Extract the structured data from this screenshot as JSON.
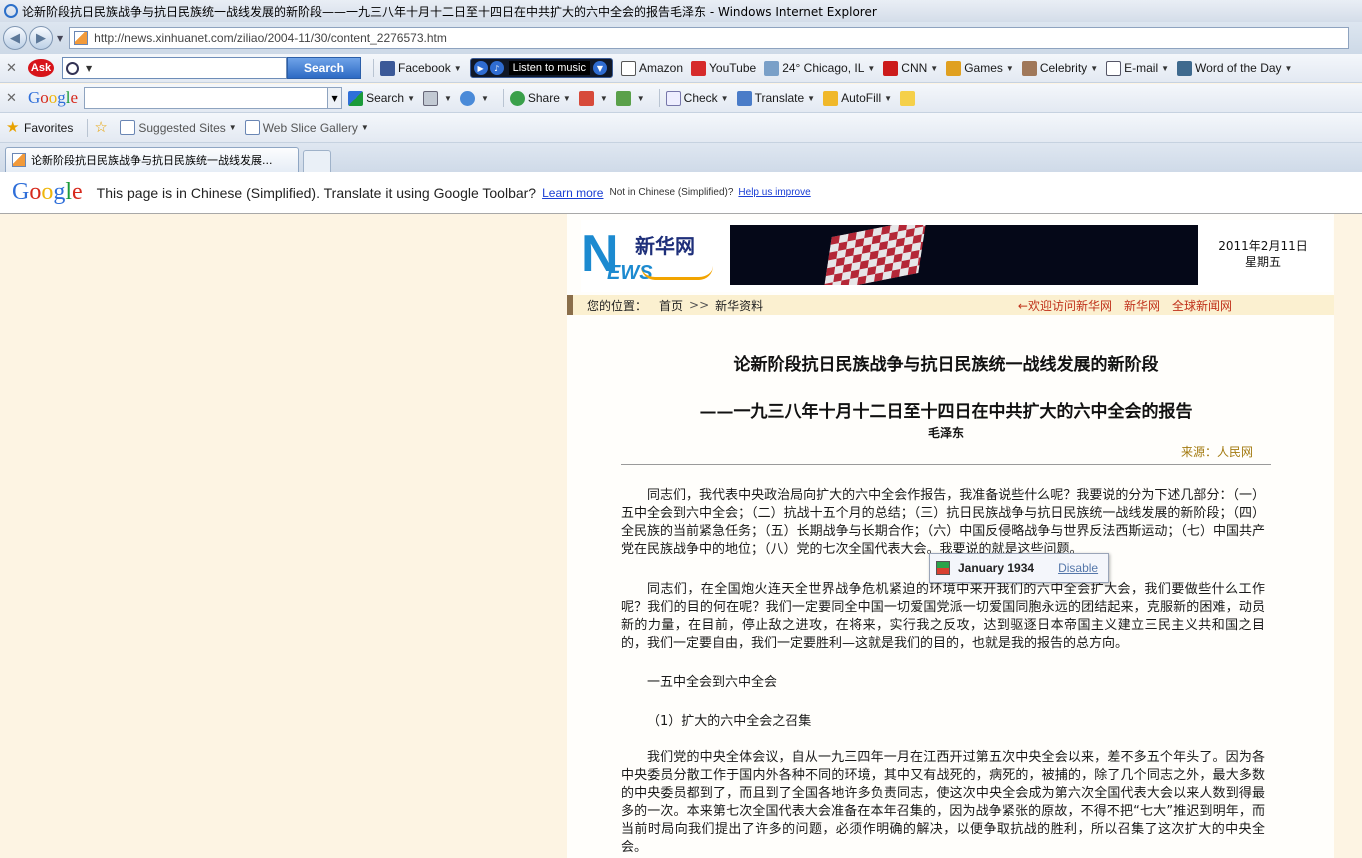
{
  "window": {
    "title": "论新阶段抗日民族战争与抗日民族统一战线发展的新阶段——一九三八年十月十二日至十四日在中共扩大的六中全会的报告毛泽东 - Windows Internet Explorer"
  },
  "address": {
    "url": "http://news.xinhuanet.com/ziliao/2004-11/30/content_2276573.htm"
  },
  "ask_toolbar": {
    "search_button": "Search",
    "music_label": "Listen to music",
    "items": [
      "Facebook",
      "Amazon",
      "YouTube",
      "24° Chicago, IL",
      "CNN",
      "Games",
      "Celebrity",
      "E-mail",
      "Word of the Day"
    ]
  },
  "google_toolbar": {
    "logo": "Google",
    "items": [
      "Search",
      "Share",
      "Check",
      "Translate",
      "AutoFill"
    ]
  },
  "favorites_bar": {
    "favorites": "Favorites",
    "suggested": "Suggested Sites",
    "webslice": "Web Slice Gallery"
  },
  "tab": {
    "title": "论新阶段抗日民族战争与抗日民族统一战线发展..."
  },
  "translate_bar": {
    "logo": "Google",
    "message": "This page is in Chinese (Simplified).  Translate it using Google Toolbar?",
    "learn_more": "Learn more",
    "not_in": "Not in Chinese (Simplified)?",
    "help": "Help us improve"
  },
  "masthead": {
    "logo_cn": "新华网",
    "logo_en_rest": "EWS",
    "date": "2011年2月11日",
    "weekday": "星期五"
  },
  "breadcrumb": {
    "label": "您的位置：",
    "home": "首页",
    "arrow": ">>",
    "section": "新华资料",
    "right_links": [
      "←欢迎访问新华网",
      "新华网",
      "全球新闻网"
    ]
  },
  "article": {
    "title": "论新阶段抗日民族战争与抗日民族统一战线发展的新阶段",
    "subtitle": "——一九三八年十月十二日至十四日在中共扩大的六中全会的报告",
    "author": "毛泽东",
    "source": "来源：人民网",
    "p1": "同志们，我代表中央政治局向扩大的六中全会作报告，我准备说些什么呢？我要说的分为下述几部分：（一）五中全会到六中全会；（二）抗战十五个月的总结；（三）抗日民族战争与抗日民族统一战线发展的新阶段；（四）全民族的当前紧急任务；（五）长期战争与长期合作；（六）中国反侵略战争与世界反法西斯运动；（七）中国共产党在民族战争中的地位；（八）党的七次全国代表大会。我要说的就是这些问题。",
    "p2": "同志们，在全国炮火连天全世界战争危机紧迫的环境中来开我们的六中全会扩大会，我们要做些什么工作呢？我们的目的何在呢？我们一定要同全中国一切爱国党派一切爱国同胞永远的团结起来，克服新的困难，动员新的力量，在目前，停止敌之进攻，在将来，实行我之反攻，达到驱逐日本帝国主义建立三民主义共和国之目的，我们一定要自由，我们一定要胜利—这就是我们的目的，也就是我的报告的总方向。",
    "section1": "一五中全会到六中全会",
    "section1_sub": "（1）扩大的六中全会之召集",
    "p3": "我们党的中央全体会议，自从一九三四年一月在江西开过第五次中央全会以来，差不多五个年头了。因为各中央委员分散工作于国内外各种不同的环境，其中又有战死的，病死的，被捕的，除了几个同志之外，最大多数的中央委员都到了，而且到了全国各地许多负责同志，使这次中央全会成为第六次全国代表大会以来人数到得最多的一次。本来第七次全国代表大会准备在本年召集的，因为战争紧张的原故，不得不把“七大”推迟到明年，而当前时局向我们提出了许多的问题，必须作明确的解决，以便争取抗战的胜利，所以召集了这次扩大的中央全会。"
  },
  "tooltip": {
    "text": "January 1934",
    "disable": "Disable"
  }
}
